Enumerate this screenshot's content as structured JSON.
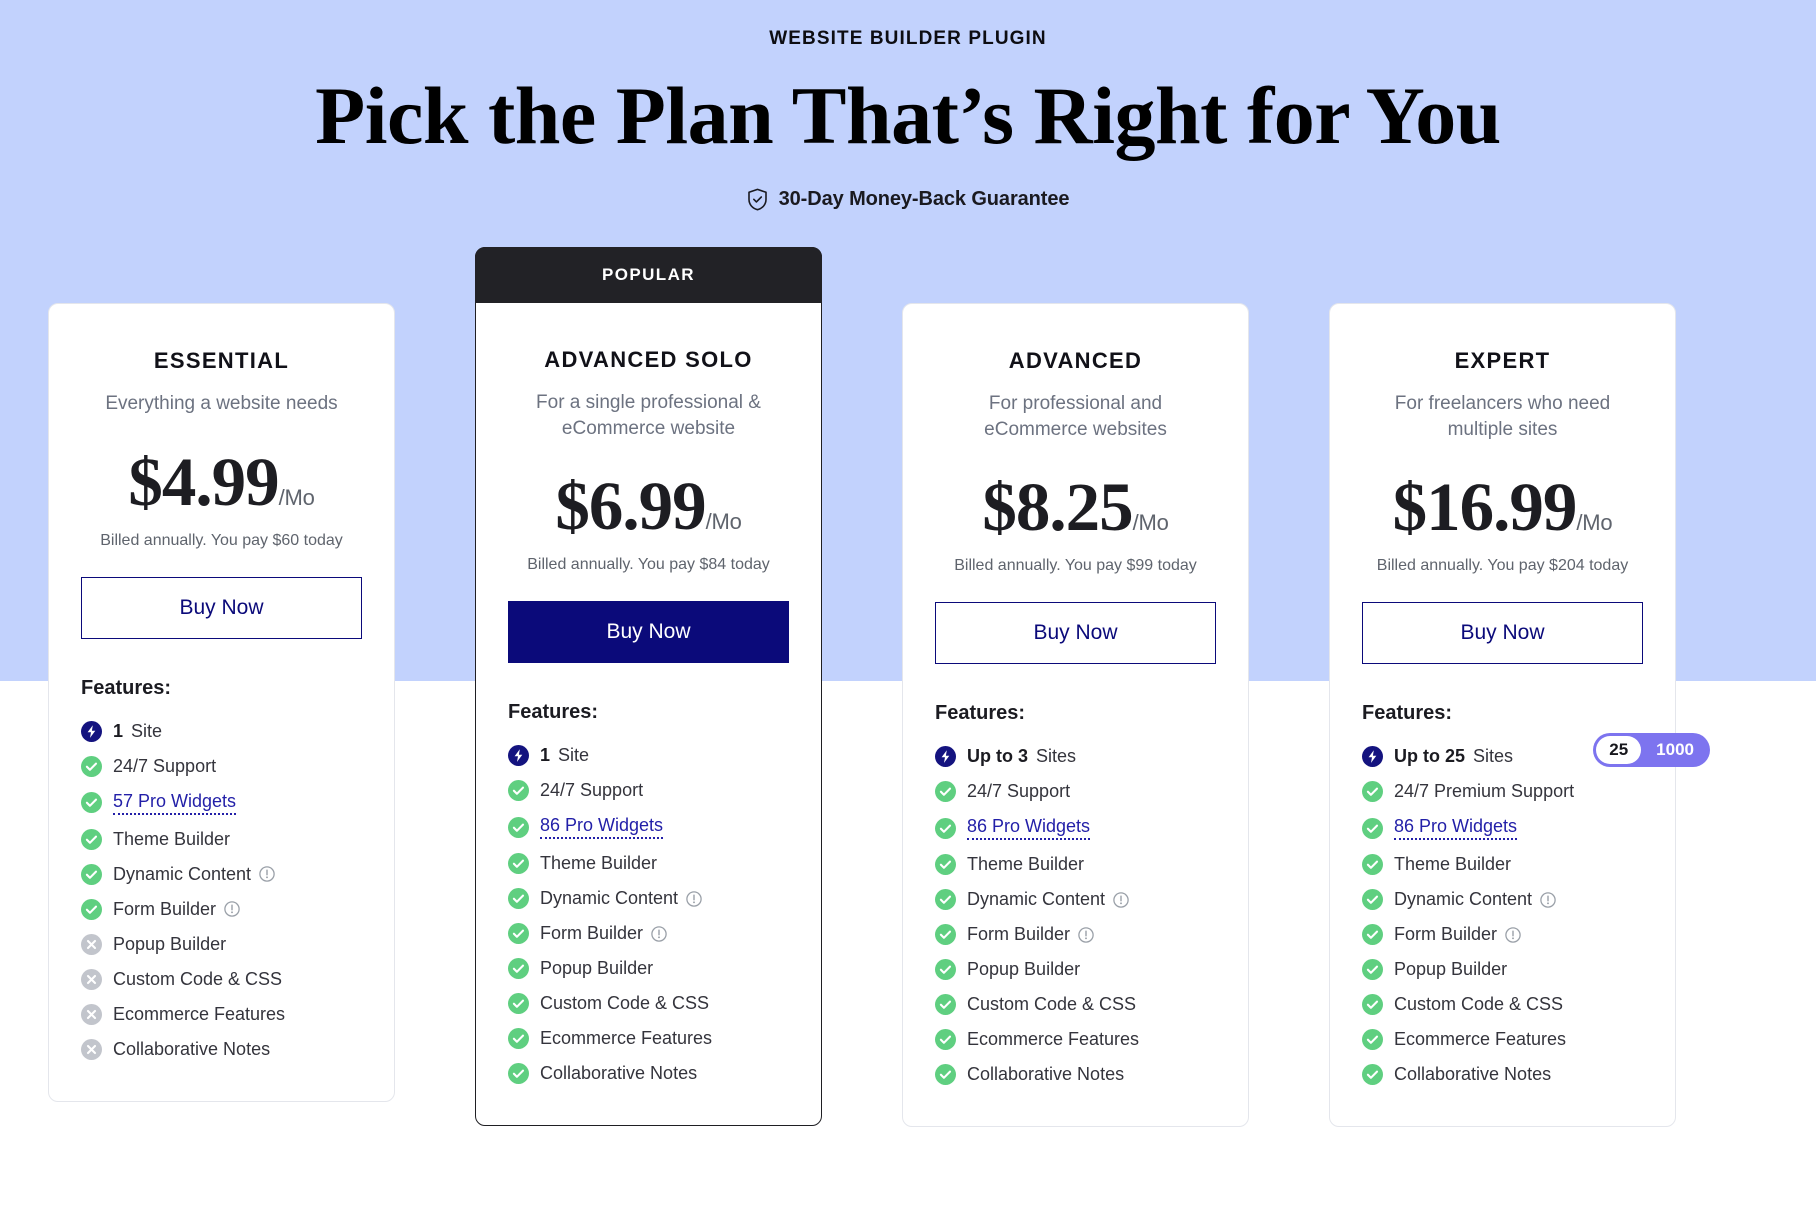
{
  "header": {
    "eyebrow": "WEBSITE BUILDER PLUGIN",
    "headline": "Pick the Plan That’s Right for You",
    "guarantee": "30-Day Money-Back Guarantee",
    "guarantee_icon": "shield-check-icon"
  },
  "colors": {
    "background_band": "#c2d2fd",
    "accent_navy": "#0b0a7a",
    "link_navy": "#221fa8",
    "check_green": "#5fcf80",
    "cross_gray": "#c2c5cc",
    "popular_banner": "#222226",
    "toggle_purple": "#7d74ef"
  },
  "plans": [
    {
      "badge": "",
      "name": "ESSENTIAL",
      "desc": "Everything a website needs",
      "price": "$4.99",
      "per": "/Mo",
      "billed": "Billed annually. You pay $60 today",
      "cta": "Buy Now",
      "cta_style": "outline",
      "features_title": "Features:",
      "features": [
        {
          "icon": "bolt-icon",
          "strong": "1",
          "label": "Site",
          "info": false
        },
        {
          "icon": "check-icon",
          "label": "24/7 Support",
          "info": false
        },
        {
          "icon": "check-icon",
          "label": "57 Pro Widgets",
          "link": true,
          "info": false
        },
        {
          "icon": "check-icon",
          "label": "Theme Builder",
          "info": false
        },
        {
          "icon": "check-icon",
          "label": "Dynamic Content",
          "info": true
        },
        {
          "icon": "check-icon",
          "label": "Form Builder",
          "info": true
        },
        {
          "icon": "cross-icon",
          "label": "Popup Builder",
          "info": false
        },
        {
          "icon": "cross-icon",
          "label": "Custom Code & CSS",
          "info": false
        },
        {
          "icon": "cross-icon",
          "label": "Ecommerce Features",
          "info": false
        },
        {
          "icon": "cross-icon",
          "label": "Collaborative Notes",
          "info": false
        }
      ]
    },
    {
      "badge": "POPULAR",
      "name": "ADVANCED SOLO",
      "desc": "For a single professional & eCommerce website",
      "price": "$6.99",
      "per": "/Mo",
      "billed": "Billed annually. You pay $84 today",
      "cta": "Buy Now",
      "cta_style": "filled",
      "features_title": "Features:",
      "features": [
        {
          "icon": "bolt-icon",
          "strong": "1",
          "label": "Site",
          "info": false
        },
        {
          "icon": "check-icon",
          "label": "24/7 Support",
          "info": false
        },
        {
          "icon": "check-icon",
          "label": "86 Pro Widgets",
          "link": true,
          "info": false
        },
        {
          "icon": "check-icon",
          "label": "Theme Builder",
          "info": false
        },
        {
          "icon": "check-icon",
          "label": "Dynamic Content",
          "info": true
        },
        {
          "icon": "check-icon",
          "label": "Form Builder",
          "info": true
        },
        {
          "icon": "check-icon",
          "label": "Popup Builder",
          "info": false
        },
        {
          "icon": "check-icon",
          "label": "Custom Code & CSS",
          "info": false
        },
        {
          "icon": "check-icon",
          "label": "Ecommerce Features",
          "info": false
        },
        {
          "icon": "check-icon",
          "label": "Collaborative Notes",
          "info": false
        }
      ]
    },
    {
      "badge": "",
      "name": "ADVANCED",
      "desc": "For professional and eCommerce websites",
      "price": "$8.25",
      "per": "/Mo",
      "billed": "Billed annually. You pay $99 today",
      "cta": "Buy Now",
      "cta_style": "outline",
      "features_title": "Features:",
      "features": [
        {
          "icon": "bolt-icon",
          "strong": "Up to 3",
          "label": "Sites",
          "info": false
        },
        {
          "icon": "check-icon",
          "label": "24/7 Support",
          "info": false
        },
        {
          "icon": "check-icon",
          "label": "86 Pro Widgets",
          "link": true,
          "info": false
        },
        {
          "icon": "check-icon",
          "label": "Theme Builder",
          "info": false
        },
        {
          "icon": "check-icon",
          "label": "Dynamic Content",
          "info": true
        },
        {
          "icon": "check-icon",
          "label": "Form Builder",
          "info": true
        },
        {
          "icon": "check-icon",
          "label": "Popup Builder",
          "info": false
        },
        {
          "icon": "check-icon",
          "label": "Custom Code & CSS",
          "info": false
        },
        {
          "icon": "check-icon",
          "label": "Ecommerce Features",
          "info": false
        },
        {
          "icon": "check-icon",
          "label": "Collaborative Notes",
          "info": false
        }
      ]
    },
    {
      "badge": "",
      "name": "EXPERT",
      "desc": "For freelancers who need multiple sites",
      "price": "$16.99",
      "per": "/Mo",
      "billed": "Billed annually. You pay $204 today",
      "cta": "Buy Now",
      "cta_style": "outline",
      "features_title": "Features:",
      "toggle": {
        "options": [
          "25",
          "1000"
        ],
        "selected": "25"
      },
      "features": [
        {
          "icon": "bolt-icon",
          "strong": "Up to 25",
          "label": "Sites",
          "info": false
        },
        {
          "icon": "check-icon",
          "label": "24/7 Premium Support",
          "info": false
        },
        {
          "icon": "check-icon",
          "label": "86 Pro Widgets",
          "link": true,
          "info": false
        },
        {
          "icon": "check-icon",
          "label": "Theme Builder",
          "info": false
        },
        {
          "icon": "check-icon",
          "label": "Dynamic Content",
          "info": true
        },
        {
          "icon": "check-icon",
          "label": "Form Builder",
          "info": true
        },
        {
          "icon": "check-icon",
          "label": "Popup Builder",
          "info": false
        },
        {
          "icon": "check-icon",
          "label": "Custom Code & CSS",
          "info": false
        },
        {
          "icon": "check-icon",
          "label": "Ecommerce Features",
          "info": false
        },
        {
          "icon": "check-icon",
          "label": "Collaborative Notes",
          "info": false
        }
      ]
    }
  ]
}
